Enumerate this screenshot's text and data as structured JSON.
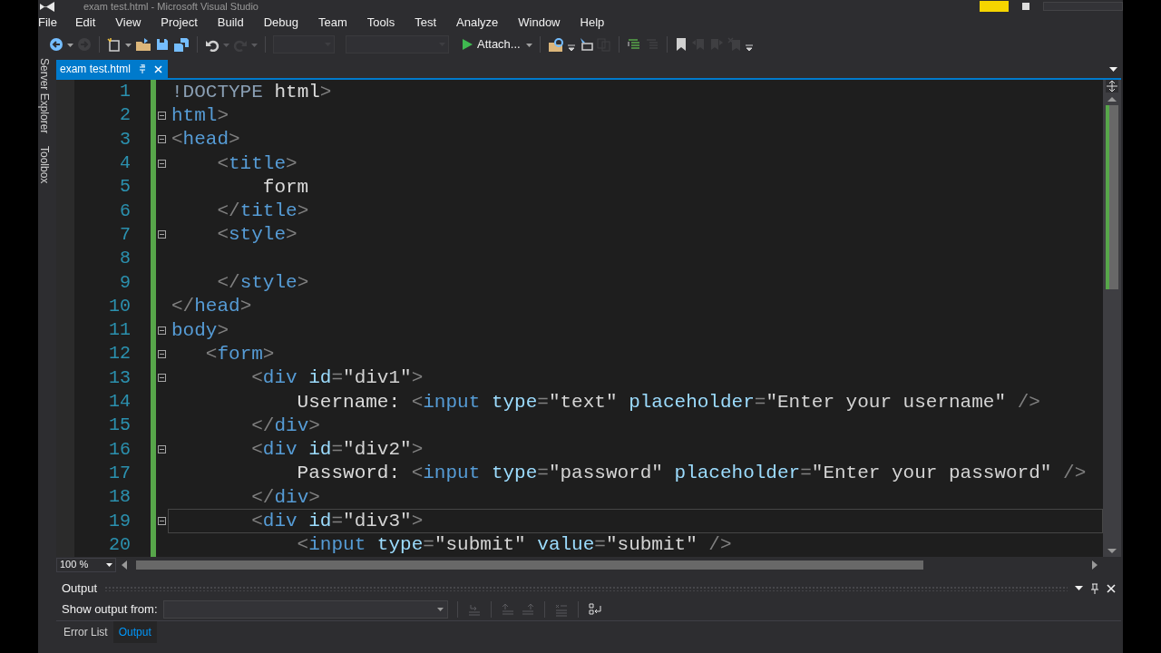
{
  "window": {
    "title": "exam test.html - Microsoft Visual Studio"
  },
  "menu": [
    "File",
    "Edit",
    "View",
    "Project",
    "Build",
    "Debug",
    "Team",
    "Tools",
    "Test",
    "Analyze",
    "Window",
    "Help"
  ],
  "toolbar": [
    {
      "kind": "back",
      "disabled": false
    },
    {
      "kind": "dropdown",
      "disabled": false
    },
    {
      "kind": "forward",
      "disabled": true
    },
    {
      "kind": "separator"
    },
    {
      "kind": "new-project",
      "disabled": false
    },
    {
      "kind": "dropdown",
      "disabled": false
    },
    {
      "kind": "open",
      "disabled": false
    },
    {
      "kind": "save",
      "disabled": false
    },
    {
      "kind": "save-all",
      "disabled": false
    },
    {
      "kind": "separator"
    },
    {
      "kind": "undo",
      "disabled": false
    },
    {
      "kind": "dropdown",
      "disabled": true
    },
    {
      "kind": "redo",
      "disabled": true
    },
    {
      "kind": "dropdown",
      "disabled": true
    },
    {
      "kind": "separator"
    },
    {
      "kind": "combo",
      "disabled": true
    },
    {
      "kind": "combo-wide",
      "disabled": true
    },
    {
      "kind": "run",
      "label": "Attach...",
      "disabled": false
    },
    {
      "kind": "dropdown",
      "disabled": false
    },
    {
      "kind": "separator"
    },
    {
      "kind": "find",
      "disabled": false
    },
    {
      "kind": "overflow",
      "disabled": false
    },
    {
      "kind": "select-box",
      "disabled": false
    },
    {
      "kind": "copy",
      "disabled": true
    },
    {
      "kind": "separator"
    },
    {
      "kind": "comment",
      "disabled": false
    },
    {
      "kind": "uncomment",
      "disabled": true
    },
    {
      "kind": "separator"
    },
    {
      "kind": "bookmark",
      "disabled": false
    },
    {
      "kind": "bookmark-prev",
      "disabled": true
    },
    {
      "kind": "bookmark-next",
      "disabled": true
    },
    {
      "kind": "bookmark-clear",
      "disabled": true
    },
    {
      "kind": "overflow",
      "disabled": false
    }
  ],
  "side_tabs": [
    "Server Explorer",
    "Toolbox"
  ],
  "doc_tabs": [
    {
      "label": "exam test.html",
      "selected": true
    }
  ],
  "code": [
    {
      "number": "1",
      "foldable": false,
      "current": false,
      "tokens": [
        {
          "kind": "doctype",
          "text": "!DOCTYPE "
        },
        {
          "kind": "text",
          "text": "html"
        },
        {
          "kind": "punct",
          "text": ">"
        }
      ]
    },
    {
      "number": "2",
      "foldable": true,
      "current": false,
      "tokens": [
        {
          "kind": "tag",
          "text": "html"
        },
        {
          "kind": "punct",
          "text": ">"
        }
      ]
    },
    {
      "number": "3",
      "foldable": true,
      "current": false,
      "tokens": [
        {
          "kind": "punct",
          "text": "<"
        },
        {
          "kind": "tag",
          "text": "head"
        },
        {
          "kind": "punct",
          "text": ">"
        }
      ]
    },
    {
      "number": "4",
      "foldable": true,
      "current": false,
      "tokens": [
        {
          "kind": "punct",
          "text": "    <"
        },
        {
          "kind": "tag",
          "text": "title"
        },
        {
          "kind": "punct",
          "text": ">"
        }
      ]
    },
    {
      "number": "5",
      "foldable": false,
      "current": false,
      "tokens": [
        {
          "kind": "text",
          "text": "        form"
        }
      ]
    },
    {
      "number": "6",
      "foldable": false,
      "current": false,
      "tokens": [
        {
          "kind": "punct",
          "text": "    </"
        },
        {
          "kind": "tag",
          "text": "title"
        },
        {
          "kind": "punct",
          "text": ">"
        }
      ]
    },
    {
      "number": "7",
      "foldable": true,
      "current": false,
      "tokens": [
        {
          "kind": "punct",
          "text": "    <"
        },
        {
          "kind": "tag",
          "text": "style"
        },
        {
          "kind": "punct",
          "text": ">"
        }
      ]
    },
    {
      "number": "8",
      "foldable": false,
      "current": false
    },
    {
      "number": "9",
      "foldable": false,
      "current": false,
      "tokens": [
        {
          "kind": "punct",
          "text": "    </"
        },
        {
          "kind": "tag",
          "text": "style"
        },
        {
          "kind": "punct",
          "text": ">"
        }
      ]
    },
    {
      "number": "10",
      "foldable": false,
      "current": false,
      "tokens": [
        {
          "kind": "punct",
          "text": "</"
        },
        {
          "kind": "tag",
          "text": "head"
        },
        {
          "kind": "punct",
          "text": ">"
        }
      ]
    },
    {
      "number": "11",
      "foldable": true,
      "current": false,
      "tokens": [
        {
          "kind": "tag",
          "text": "body"
        },
        {
          "kind": "punct",
          "text": ">"
        }
      ]
    },
    {
      "number": "12",
      "foldable": true,
      "current": false,
      "tokens": [
        {
          "kind": "punct",
          "text": "   <"
        },
        {
          "kind": "tag",
          "text": "form"
        },
        {
          "kind": "punct",
          "text": ">"
        }
      ]
    },
    {
      "number": "13",
      "foldable": true,
      "current": false,
      "tokens": [
        {
          "kind": "punct",
          "text": "       <"
        },
        {
          "kind": "tag",
          "text": "div"
        },
        {
          "kind": "attr",
          "text": " id"
        },
        {
          "kind": "punct",
          "text": "="
        },
        {
          "kind": "string",
          "text": "\"div1\""
        },
        {
          "kind": "punct",
          "text": ">"
        }
      ]
    },
    {
      "number": "14",
      "foldable": false,
      "current": false,
      "tokens": [
        {
          "kind": "text",
          "text": "           Username: "
        },
        {
          "kind": "punct",
          "text": "<"
        },
        {
          "kind": "tag",
          "text": "input"
        },
        {
          "kind": "attr",
          "text": " type"
        },
        {
          "kind": "punct",
          "text": "="
        },
        {
          "kind": "string",
          "text": "\"text\""
        },
        {
          "kind": "attr",
          "text": " placeholder"
        },
        {
          "kind": "punct",
          "text": "="
        },
        {
          "kind": "string",
          "text": "\"Enter your username\""
        },
        {
          "kind": "punct",
          "text": " />"
        }
      ]
    },
    {
      "number": "15",
      "foldable": false,
      "current": false,
      "tokens": [
        {
          "kind": "punct",
          "text": "       </"
        },
        {
          "kind": "tag",
          "text": "div"
        },
        {
          "kind": "punct",
          "text": ">"
        }
      ]
    },
    {
      "number": "16",
      "foldable": true,
      "current": false,
      "tokens": [
        {
          "kind": "punct",
          "text": "       <"
        },
        {
          "kind": "tag",
          "text": "div"
        },
        {
          "kind": "attr",
          "text": " id"
        },
        {
          "kind": "punct",
          "text": "="
        },
        {
          "kind": "string",
          "text": "\"div2\""
        },
        {
          "kind": "punct",
          "text": ">"
        }
      ]
    },
    {
      "number": "17",
      "foldable": false,
      "current": false,
      "tokens": [
        {
          "kind": "text",
          "text": "           Password: "
        },
        {
          "kind": "punct",
          "text": "<"
        },
        {
          "kind": "tag",
          "text": "input"
        },
        {
          "kind": "attr",
          "text": " type"
        },
        {
          "kind": "punct",
          "text": "="
        },
        {
          "kind": "string",
          "text": "\"password\""
        },
        {
          "kind": "attr",
          "text": " placeholder"
        },
        {
          "kind": "punct",
          "text": "="
        },
        {
          "kind": "string",
          "text": "\"Enter your password\""
        },
        {
          "kind": "punct",
          "text": " />"
        }
      ]
    },
    {
      "number": "18",
      "foldable": false,
      "current": false,
      "tokens": [
        {
          "kind": "punct",
          "text": "       </"
        },
        {
          "kind": "tag",
          "text": "div"
        },
        {
          "kind": "punct",
          "text": ">"
        }
      ]
    },
    {
      "number": "19",
      "foldable": true,
      "current": true,
      "tokens": [
        {
          "kind": "punct",
          "text": "       <"
        },
        {
          "kind": "tag",
          "text": "div"
        },
        {
          "kind": "attr",
          "text": " id"
        },
        {
          "kind": "punct",
          "text": "="
        },
        {
          "kind": "string",
          "text": "\"div3\""
        },
        {
          "kind": "punct",
          "text": ">"
        }
      ]
    },
    {
      "number": "20",
      "foldable": false,
      "current": false,
      "tokens": [
        {
          "kind": "punct",
          "text": "           <"
        },
        {
          "kind": "tag",
          "text": "input"
        },
        {
          "kind": "attr",
          "text": " type"
        },
        {
          "kind": "punct",
          "text": "="
        },
        {
          "kind": "string",
          "text": "\"submit\""
        },
        {
          "kind": "attr",
          "text": " value"
        },
        {
          "kind": "punct",
          "text": "="
        },
        {
          "kind": "string",
          "text": "\"submit\""
        },
        {
          "kind": "punct",
          "text": " />"
        }
      ]
    }
  ],
  "zoom": {
    "value": "100 %"
  },
  "output": {
    "title": "Output",
    "source_label": "Show output from:"
  },
  "bottom_tabs": [
    {
      "label": "Error List",
      "selected": false
    },
    {
      "label": "Output",
      "selected": true
    }
  ]
}
